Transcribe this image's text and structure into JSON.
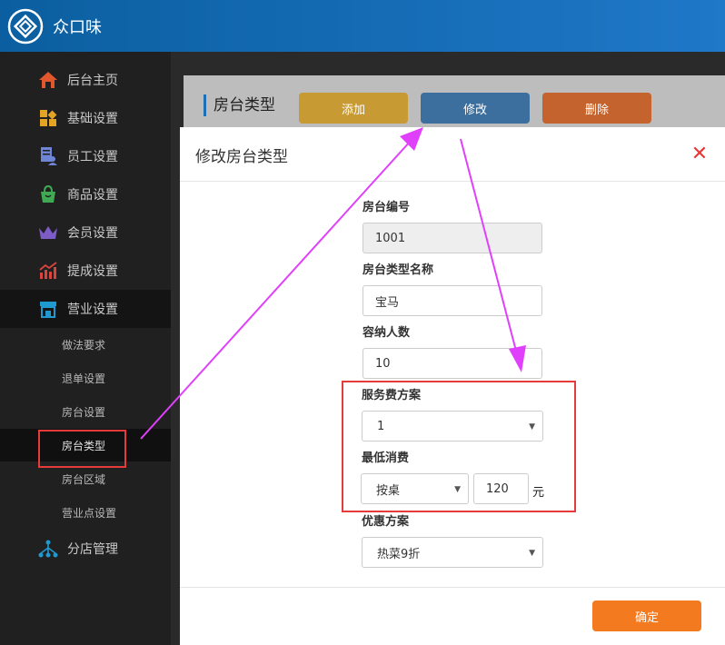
{
  "app": {
    "brand": "众口味"
  },
  "sidebar": {
    "items": [
      {
        "label": "后台主页",
        "icon": "home-icon",
        "color": "#e2572b"
      },
      {
        "label": "基础设置",
        "icon": "grid-icon",
        "color": "#e3a324"
      },
      {
        "label": "员工设置",
        "icon": "staff-icon",
        "color": "#6f86d6"
      },
      {
        "label": "商品设置",
        "icon": "bag-icon",
        "color": "#3faa53"
      },
      {
        "label": "会员设置",
        "icon": "crown-icon",
        "color": "#7e5cc7"
      },
      {
        "label": "提成设置",
        "icon": "chart-icon",
        "color": "#d9443c"
      },
      {
        "label": "营业设置",
        "icon": "store-icon",
        "color": "#1f9ad0"
      },
      {
        "label": "分店管理",
        "icon": "branch-icon",
        "color": "#1f9ad0"
      }
    ],
    "sub_items": [
      {
        "label": "做法要求"
      },
      {
        "label": "退单设置"
      },
      {
        "label": "房台设置"
      },
      {
        "label": "房台类型"
      },
      {
        "label": "房台区域"
      },
      {
        "label": "营业点设置"
      }
    ]
  },
  "toolbar": {
    "title": "房台类型",
    "add_label": "添加",
    "edit_label": "修改",
    "delete_label": "删除",
    "add_color": "#c79a34",
    "edit_color": "#3d6f9e",
    "delete_color": "#c4632e"
  },
  "modal": {
    "title": "修改房台类型",
    "close": "✕",
    "fields": {
      "code_label": "房台编号",
      "code_value": "1001",
      "name_label": "房台类型名称",
      "name_value": "宝马",
      "capacity_label": "容纳人数",
      "capacity_value": "10",
      "service_label": "服务费方案",
      "service_value": "1",
      "min_label": "最低消费",
      "min_mode_value": "按桌",
      "min_amount_value": "120",
      "min_unit": "元",
      "discount_label": "优惠方案",
      "discount_value": "热菜9折"
    },
    "confirm_label": "确定"
  },
  "colors": {
    "header": "#1a6db3",
    "accent": "#f47a1f",
    "annotation_box": "#e53b3b",
    "annotation_arrow": "#e040fb"
  }
}
